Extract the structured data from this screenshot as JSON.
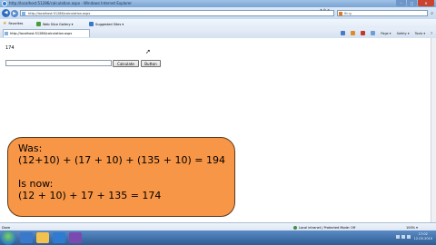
{
  "window": {
    "title": "http://localhost:51286/calculation.aspx - Windows Internet Explorer",
    "minimize": "–",
    "maximize": "□",
    "close": "✕"
  },
  "address_bar": {
    "url": "http://localhost:51286/calculation.aspx",
    "icons": "✦ ⟳ ✕",
    "search_engine": "Bing",
    "search_placeholder": "Bing"
  },
  "favorites_bar": {
    "favorites_label": "Favorites",
    "items": [
      "Web Slice Gallery ▾",
      "Suggested Sites ▾"
    ]
  },
  "tab": {
    "label": "http://localhost:51286/calculation.aspx"
  },
  "command_bar": {
    "page": "Page ▾",
    "safety": "Safety ▾",
    "tools": "Tools ▾",
    "help": "?",
    "icon_colors": [
      "#4a7bc0",
      "#e08a2a",
      "#c0392b",
      "#6a9fd8"
    ]
  },
  "page": {
    "result": "174",
    "input_value": "",
    "calculate_button": "Calculate",
    "second_button": "Button"
  },
  "callout": {
    "line1": "Was:",
    "line2": "(12+10) + (17 + 10) + (135 + 10) = 194",
    "line3": "Is now:",
    "line4": "(12 + 10) + 17 + 135 = 174",
    "color": "#f79646"
  },
  "status_bar": {
    "status": "Done",
    "zone": "Local intranet | Protected Mode: Off",
    "zoom": "100% ▾"
  },
  "taskbar": {
    "time": "17:02",
    "date": "12-05-2010",
    "icon_colors": [
      "#3a78c9",
      "#f2c14e",
      "#2f7bd0",
      "#7b4ab0"
    ]
  }
}
